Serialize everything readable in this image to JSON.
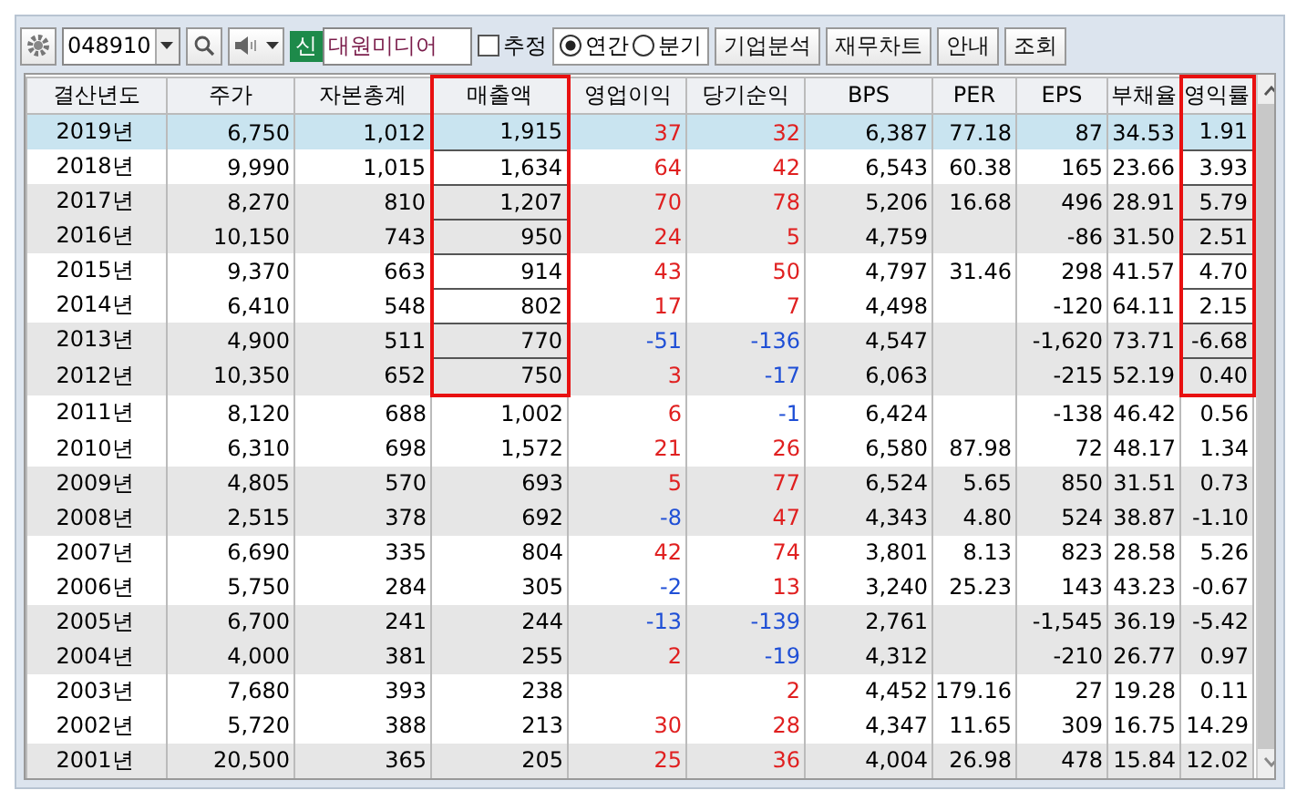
{
  "toolbar": {
    "code": "048910",
    "badge": "신",
    "name": "대원미디어",
    "estimate": {
      "label": "추정",
      "checked": false
    },
    "period": [
      {
        "label": "연간",
        "selected": true
      },
      {
        "label": "분기",
        "selected": false
      }
    ],
    "buttons": [
      "기업분석",
      "재무차트",
      "안내",
      "조회"
    ]
  },
  "columns": [
    {
      "label": "결산년도",
      "boxed": false
    },
    {
      "label": "주가",
      "boxed": false
    },
    {
      "label": "자본총계",
      "boxed": false
    },
    {
      "label": "매출액",
      "boxed": true
    },
    {
      "label": "영업이익",
      "boxed": false
    },
    {
      "label": "당기순익",
      "boxed": false
    },
    {
      "label": "BPS",
      "boxed": false
    },
    {
      "label": "PER",
      "boxed": false
    },
    {
      "label": "EPS",
      "boxed": false
    },
    {
      "label": "부채율",
      "boxed": false
    },
    {
      "label": "영익률",
      "boxed": true
    }
  ],
  "rows": [
    {
      "selected": true,
      "boxed": true,
      "cells": [
        "2019년",
        "6,750",
        "1,012",
        "1,915",
        {
          "text": "37",
          "negative": false
        },
        {
          "text": "32",
          "negative": false
        },
        "6,387",
        "77.18",
        "87",
        "34.53",
        "1.91"
      ]
    },
    {
      "selected": false,
      "boxed": true,
      "cells": [
        "2018년",
        "9,990",
        "1,015",
        "1,634",
        {
          "text": "64",
          "negative": false
        },
        {
          "text": "42",
          "negative": false
        },
        "6,543",
        "60.38",
        "165",
        "23.66",
        "3.93"
      ]
    },
    {
      "selected": false,
      "boxed": true,
      "cells": [
        "2017년",
        "8,270",
        "810",
        "1,207",
        {
          "text": "70",
          "negative": false
        },
        {
          "text": "78",
          "negative": false
        },
        "5,206",
        "16.68",
        "496",
        "28.91",
        "5.79"
      ]
    },
    {
      "selected": false,
      "boxed": true,
      "cells": [
        "2016년",
        "10,150",
        "743",
        "950",
        {
          "text": "24",
          "negative": false
        },
        {
          "text": "5",
          "negative": false
        },
        "4,759",
        "",
        "-86",
        "31.50",
        "2.51"
      ]
    },
    {
      "selected": false,
      "boxed": true,
      "cells": [
        "2015년",
        "9,370",
        "663",
        "914",
        {
          "text": "43",
          "negative": false
        },
        {
          "text": "50",
          "negative": false
        },
        "4,797",
        "31.46",
        "298",
        "41.57",
        "4.70"
      ]
    },
    {
      "selected": false,
      "boxed": true,
      "cells": [
        "2014년",
        "6,410",
        "548",
        "802",
        {
          "text": "17",
          "negative": false
        },
        {
          "text": "7",
          "negative": false
        },
        "4,498",
        "",
        "-120",
        "64.11",
        "2.15"
      ]
    },
    {
      "selected": false,
      "boxed": true,
      "cells": [
        "2013년",
        "4,900",
        "511",
        "770",
        {
          "text": "-51",
          "negative": true
        },
        {
          "text": "-136",
          "negative": true
        },
        "4,547",
        "",
        "-1,620",
        "73.71",
        "-6.68"
      ]
    },
    {
      "selected": false,
      "boxed": true,
      "cells": [
        "2012년",
        "10,350",
        "652",
        "750",
        {
          "text": "3",
          "negative": false
        },
        {
          "text": "-17",
          "negative": true
        },
        "6,063",
        "",
        "-215",
        "52.19",
        "0.40"
      ]
    },
    {
      "selected": false,
      "boxed": false,
      "cells": [
        "2011년",
        "8,120",
        "688",
        "1,002",
        {
          "text": "6",
          "negative": false
        },
        {
          "text": "-1",
          "negative": true
        },
        "6,424",
        "",
        "-138",
        "46.42",
        "0.56"
      ]
    },
    {
      "selected": false,
      "boxed": false,
      "cells": [
        "2010년",
        "6,310",
        "698",
        "1,572",
        {
          "text": "21",
          "negative": false
        },
        {
          "text": "26",
          "negative": false
        },
        "6,580",
        "87.98",
        "72",
        "48.17",
        "1.34"
      ]
    },
    {
      "selected": false,
      "boxed": false,
      "cells": [
        "2009년",
        "4,805",
        "570",
        "693",
        {
          "text": "5",
          "negative": false
        },
        {
          "text": "77",
          "negative": false
        },
        "6,524",
        "5.65",
        "850",
        "31.51",
        "0.73"
      ]
    },
    {
      "selected": false,
      "boxed": false,
      "cells": [
        "2008년",
        "2,515",
        "378",
        "692",
        {
          "text": "-8",
          "negative": true
        },
        {
          "text": "47",
          "negative": false
        },
        "4,343",
        "4.80",
        "524",
        "38.87",
        "-1.10"
      ]
    },
    {
      "selected": false,
      "boxed": false,
      "cells": [
        "2007년",
        "6,690",
        "335",
        "804",
        {
          "text": "42",
          "negative": false
        },
        {
          "text": "74",
          "negative": false
        },
        "3,801",
        "8.13",
        "823",
        "28.58",
        "5.26"
      ]
    },
    {
      "selected": false,
      "boxed": false,
      "cells": [
        "2006년",
        "5,750",
        "284",
        "305",
        {
          "text": "-2",
          "negative": true
        },
        {
          "text": "13",
          "negative": false
        },
        "3,240",
        "25.23",
        "143",
        "43.23",
        "-0.67"
      ]
    },
    {
      "selected": false,
      "boxed": false,
      "cells": [
        "2005년",
        "6,700",
        "241",
        "244",
        {
          "text": "-13",
          "negative": true
        },
        {
          "text": "-139",
          "negative": true
        },
        "2,761",
        "",
        "-1,545",
        "36.19",
        "-5.42"
      ]
    },
    {
      "selected": false,
      "boxed": false,
      "cells": [
        "2004년",
        "4,000",
        "381",
        "255",
        {
          "text": "2",
          "negative": false
        },
        {
          "text": "-19",
          "negative": true
        },
        "4,312",
        "",
        "-210",
        "26.77",
        "0.97"
      ]
    },
    {
      "selected": false,
      "boxed": false,
      "cells": [
        "2003년",
        "7,680",
        "393",
        "238",
        {
          "text": "",
          "negative": false
        },
        {
          "text": "2",
          "negative": false
        },
        "4,452",
        "179.16",
        "27",
        "19.28",
        "0.11"
      ]
    },
    {
      "selected": false,
      "boxed": false,
      "cells": [
        "2002년",
        "5,720",
        "388",
        "213",
        {
          "text": "30",
          "negative": false
        },
        {
          "text": "28",
          "negative": false
        },
        "4,347",
        "11.65",
        "309",
        "16.75",
        "14.29"
      ]
    },
    {
      "selected": false,
      "boxed": false,
      "cells": [
        "2001년",
        "20,500",
        "365",
        "205",
        {
          "text": "25",
          "negative": false
        },
        {
          "text": "36",
          "negative": false
        },
        "4,004",
        "26.98",
        "478",
        "15.84",
        "12.02"
      ]
    }
  ]
}
